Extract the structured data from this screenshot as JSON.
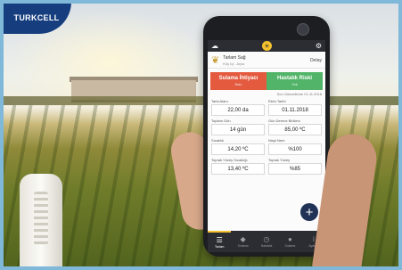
{
  "brand": {
    "logo_text": "TURKCELL"
  },
  "app": {
    "appbar": {
      "left_icon": "cloud-icon",
      "center_icon": "sun-icon",
      "right_icon": "gear-icon"
    },
    "field": {
      "name": "Tarlam Sağ",
      "location": "Köy İçi - Arpa",
      "detail_label": "Detay"
    },
    "risks": [
      {
        "label": "Sulama İhtiyacı",
        "value": "Sulu",
        "color": "#e35a3f"
      },
      {
        "label": "Hastalık Riski",
        "value": "Yok",
        "color": "#52b468"
      }
    ],
    "last_update": "Son Güncelleme 01.11.2018",
    "metrics": [
      {
        "label": "Tarla Alanı",
        "value": "22,00 da"
      },
      {
        "label": "Ekim Tarihi",
        "value": "01.11.2018"
      },
      {
        "label": "Toplam Gün",
        "value": "14 gün"
      },
      {
        "label": "Gün Derece Birikimi",
        "value": "85,00 ºC"
      },
      {
        "label": "Sıcaklık",
        "value": "14,20 ºC"
      },
      {
        "label": "Nispi Nem",
        "value": "%100"
      },
      {
        "label": "Toprak Yüzey Sıcaklığı",
        "value": "13,40 ºC"
      },
      {
        "label": "Toprak Yüzey",
        "value": "%85"
      }
    ],
    "fab_symbol": "+",
    "nav": [
      {
        "label": "Tarlam",
        "icon": "☰",
        "active": true
      },
      {
        "label": "Sulama",
        "icon": "◆",
        "active": false
      },
      {
        "label": "Hastalık",
        "icon": "◷",
        "active": false
      },
      {
        "label": "Sulama",
        "icon": "●",
        "active": false
      },
      {
        "label": "Ayarlar",
        "icon": "i",
        "active": false
      }
    ]
  }
}
